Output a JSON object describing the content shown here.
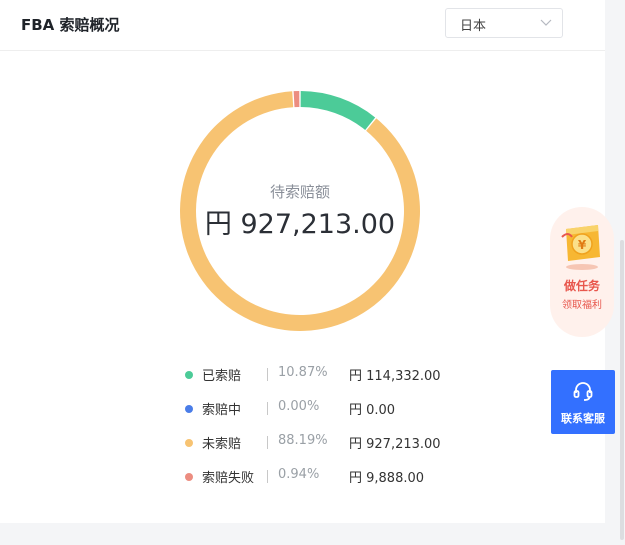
{
  "header": {
    "title": "FBA 索赔概况"
  },
  "region_select": {
    "value": "日本"
  },
  "summary": {
    "label": "待索赔额",
    "value": "円 927,213.00"
  },
  "chart_data": {
    "type": "pie",
    "donut": true,
    "categories": [
      "已索赔",
      "索赔中",
      "未索赔",
      "索赔失败"
    ],
    "values": [
      114332.0,
      0.0,
      927213.0,
      9888.0
    ],
    "percentages": [
      10.87,
      0.0,
      88.19,
      0.94
    ],
    "colors": [
      "#4ccb98",
      "#4a7de8",
      "#f7c372",
      "#ec8d80"
    ],
    "legend": "bottom"
  },
  "legend": [
    {
      "name": "已索赔",
      "percent": "10.87%",
      "amount": "円 114,332.00",
      "color": "#4ccb98"
    },
    {
      "name": "索赔中",
      "percent": "0.00%",
      "amount": "円 0.00",
      "color": "#4a7de8"
    },
    {
      "name": "未索赔",
      "percent": "88.19%",
      "amount": "円 927,213.00",
      "color": "#f7c372"
    },
    {
      "name": "索赔失败",
      "percent": "0.94%",
      "amount": "円 9,888.00",
      "color": "#ec8d80"
    }
  ],
  "task_widget": {
    "title": "做任务",
    "subtitle": "领取福利"
  },
  "support_button": {
    "label": "联系客服"
  }
}
